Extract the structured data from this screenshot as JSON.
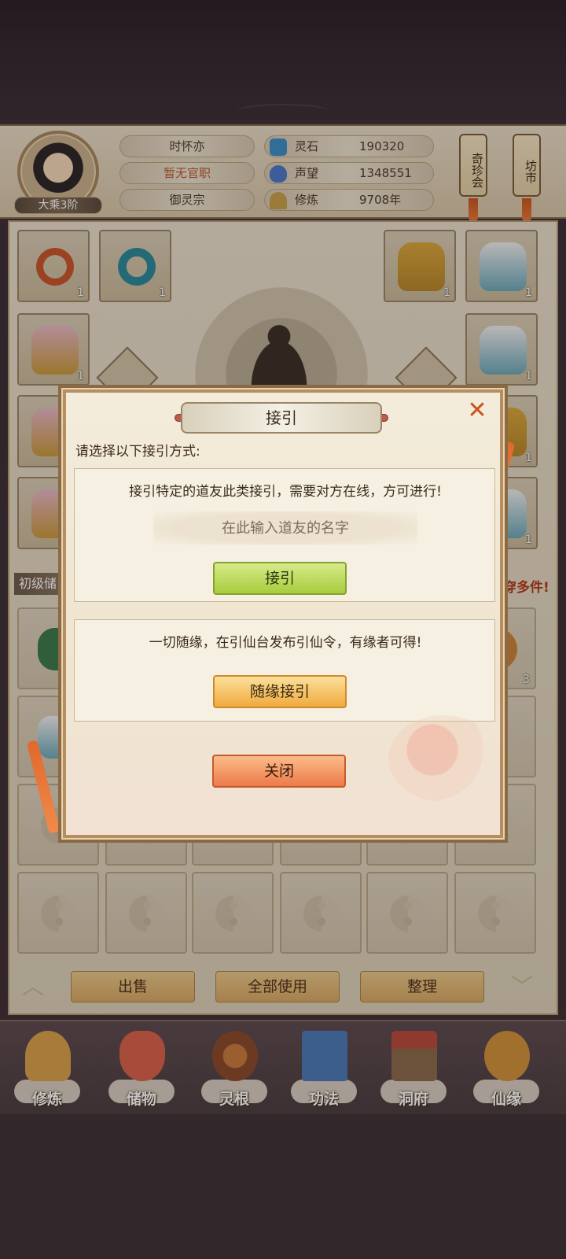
{
  "player": {
    "name": "时怀亦",
    "title": "暂无官职",
    "sect": "御灵宗",
    "realm": "大乘3阶"
  },
  "stats": [
    {
      "label": "灵石",
      "value": "190320",
      "icon": "spirit-stone-icon",
      "color": "#3a8ec8"
    },
    {
      "label": "声望",
      "value": "1348551",
      "icon": "reputation-crystal-icon",
      "color": "#4a78c8"
    },
    {
      "label": "修炼",
      "value": "9708年",
      "icon": "meditation-icon",
      "color": "#c8a04a"
    }
  ],
  "side_buttons": {
    "treasure": "奇珍会",
    "market": "坊市"
  },
  "equipment": {
    "slot_counts": [
      "1",
      "1",
      "1",
      "1",
      "1",
      "1",
      "1",
      "1",
      "1",
      "1",
      "1",
      "1"
    ]
  },
  "bag": {
    "tab_label": "初级储",
    "hint": "穿多件!",
    "item_count": "3"
  },
  "actions": {
    "sell": "出售",
    "use_all": "全部使用",
    "sort": "整理"
  },
  "nav": [
    {
      "label": "修炼",
      "icon": "cultivate-icon",
      "color": "#d9a04a"
    },
    {
      "label": "储物",
      "icon": "storage-bag-icon",
      "color": "#d8604a"
    },
    {
      "label": "灵根",
      "icon": "spirit-root-icon",
      "color": "#8a4a2a"
    },
    {
      "label": "功法",
      "icon": "technique-book-icon",
      "color": "#4a7ab8"
    },
    {
      "label": "洞府",
      "icon": "cave-mansion-icon",
      "color": "#8a6a4a"
    },
    {
      "label": "仙缘",
      "icon": "immortal-fate-icon",
      "color": "#d0903a"
    }
  ],
  "dialog": {
    "title": "接引",
    "prompt": "请选择以下接引方式:",
    "specific_desc": "接引特定的道友此类接引，需要对方在线，方可进行!",
    "name_placeholder": "在此输入道友的名字",
    "name_value": "",
    "guide_button": "接引",
    "random_desc": "一切随缘，在引仙台发布引仙令，有缘者可得!",
    "random_button": "随缘接引",
    "close_button": "关闭"
  }
}
